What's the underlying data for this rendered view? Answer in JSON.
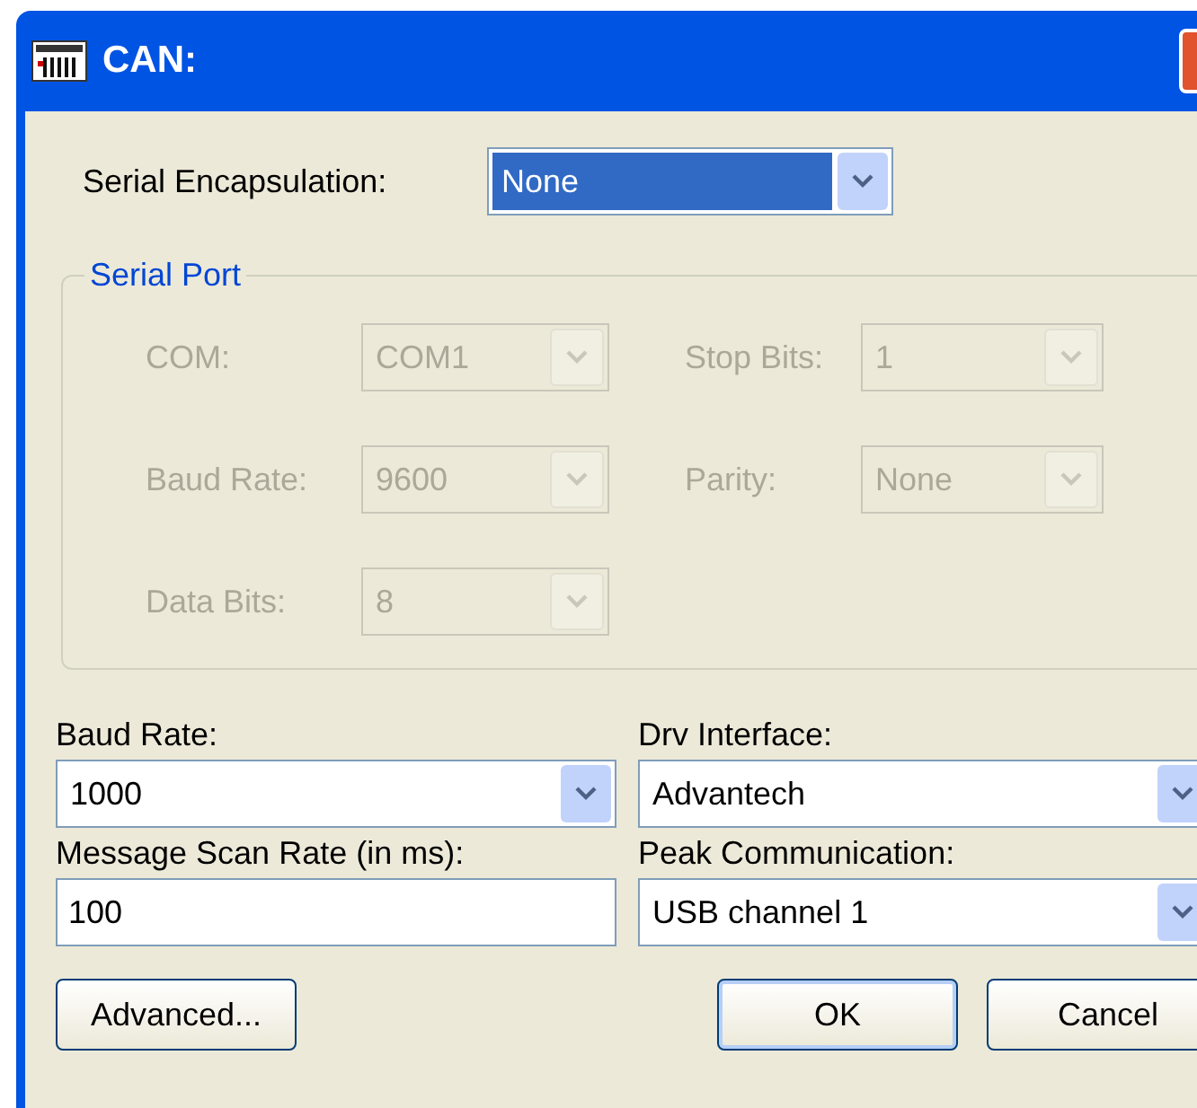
{
  "window": {
    "title": "CAN:"
  },
  "serial_encapsulation": {
    "label": "Serial Encapsulation:",
    "value": "None",
    "highlighted": true
  },
  "serial_port": {
    "title": "Serial Port",
    "fields": [
      {
        "label": "COM:",
        "value": "COM1",
        "disabled": true
      },
      {
        "label": "Stop Bits:",
        "value": "1",
        "disabled": true
      },
      {
        "label": "Baud Rate:",
        "value": "9600",
        "disabled": true
      },
      {
        "label": "Parity:",
        "value": "None",
        "disabled": true
      },
      {
        "label": "Data Bits:",
        "value": "8",
        "disabled": true
      }
    ]
  },
  "settings": [
    {
      "label": "Baud Rate:",
      "value": "1000",
      "kind": "dropdown"
    },
    {
      "label": "Drv Interface:",
      "value": "Advantech",
      "kind": "dropdown"
    },
    {
      "label": "Message Scan Rate (in ms):",
      "value": "100",
      "kind": "text"
    },
    {
      "label": "Peak Communication:",
      "value": "USB channel 1",
      "kind": "dropdown"
    }
  ],
  "buttons": [
    {
      "label": "Advanced...",
      "kind": "left"
    },
    {
      "label": "OK",
      "kind": "default"
    },
    {
      "label": "Cancel",
      "kind": "normal"
    }
  ]
}
